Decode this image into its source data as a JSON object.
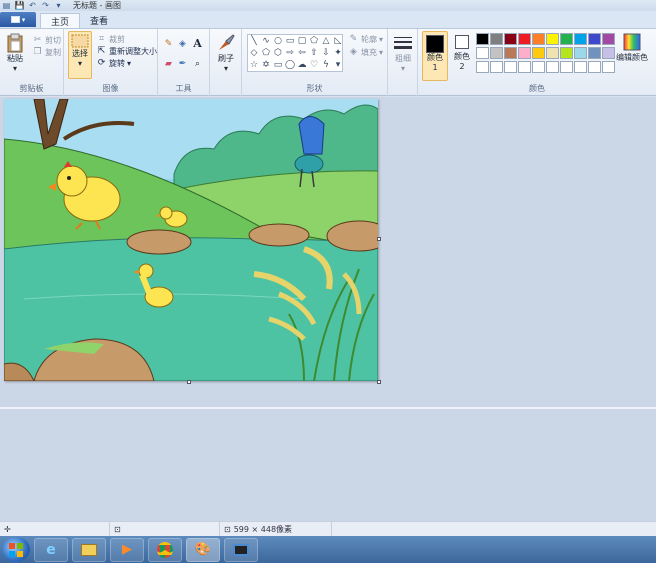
{
  "window": {
    "title": "无标题 - 画图"
  },
  "tabs": [
    {
      "label": "主页",
      "active": true
    },
    {
      "label": "查看",
      "active": false
    }
  ],
  "ribbon": {
    "clipboard": {
      "paste_label": "粘贴",
      "cut_label": "剪切",
      "copy_label": "复制",
      "group_label": "剪贴板"
    },
    "image": {
      "select_label": "选择",
      "crop_label": "裁剪",
      "resize_label": "重新调整大小",
      "rotate_label": "旋转",
      "group_label": "图像"
    },
    "tools": {
      "group_label": "工具"
    },
    "brushes": {
      "label": "刷子"
    },
    "shapes": {
      "outline_label": "轮廓",
      "fill_label": "填充",
      "group_label": "形状"
    },
    "size": {
      "label": "粗细"
    },
    "colors": {
      "color1_label": "颜色 1",
      "color2_label": "颜色 2",
      "edit_label": "编辑颜色",
      "group_label": "颜色",
      "color1": "#000000",
      "color2": "#ffffff",
      "palette_row1": [
        "#000000",
        "#7f7f7f",
        "#880015",
        "#ed1c24",
        "#ff7f27",
        "#fff200",
        "#22b14c",
        "#00a2e8",
        "#3f48cc",
        "#a349a4"
      ],
      "palette_row2": [
        "#ffffff",
        "#c3c3c3",
        "#b97a57",
        "#ffaec9",
        "#ffc90e",
        "#efe4b0",
        "#b5e61d",
        "#99d9ea",
        "#7092be",
        "#c8bfe7"
      ],
      "palette_row3": [
        "#ffffff",
        "#ffffff",
        "#ffffff",
        "#ffffff",
        "#ffffff",
        "#ffffff",
        "#ffffff",
        "#ffffff",
        "#ffffff",
        "#ffffff"
      ]
    }
  },
  "status": {
    "image_size": "599 × 448像素"
  }
}
